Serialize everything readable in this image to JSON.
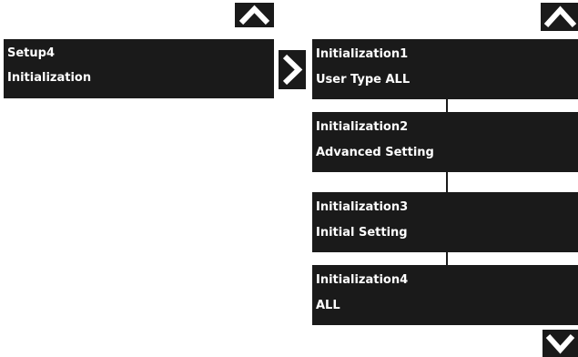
{
  "left_panel": {
    "line1": "Setup4",
    "line2": "Initialization"
  },
  "right_panels": [
    {
      "line1": "Initialization1",
      "line2": "User Type ALL"
    },
    {
      "line1": "Initialization2",
      "line2": "Advanced Setting"
    },
    {
      "line1": "Initialization3",
      "line2": "Initial Setting"
    },
    {
      "line1": "Initialization4",
      "line2": "ALL"
    }
  ],
  "icons": {
    "left_up": "chevron-up-icon",
    "right_up": "chevron-up-icon",
    "enter": "chevron-right-icon",
    "down": "chevron-down-icon"
  },
  "colors": {
    "panel_bg": "#1a1a1a",
    "text": "#ffffff",
    "page_bg": "#ffffff"
  }
}
